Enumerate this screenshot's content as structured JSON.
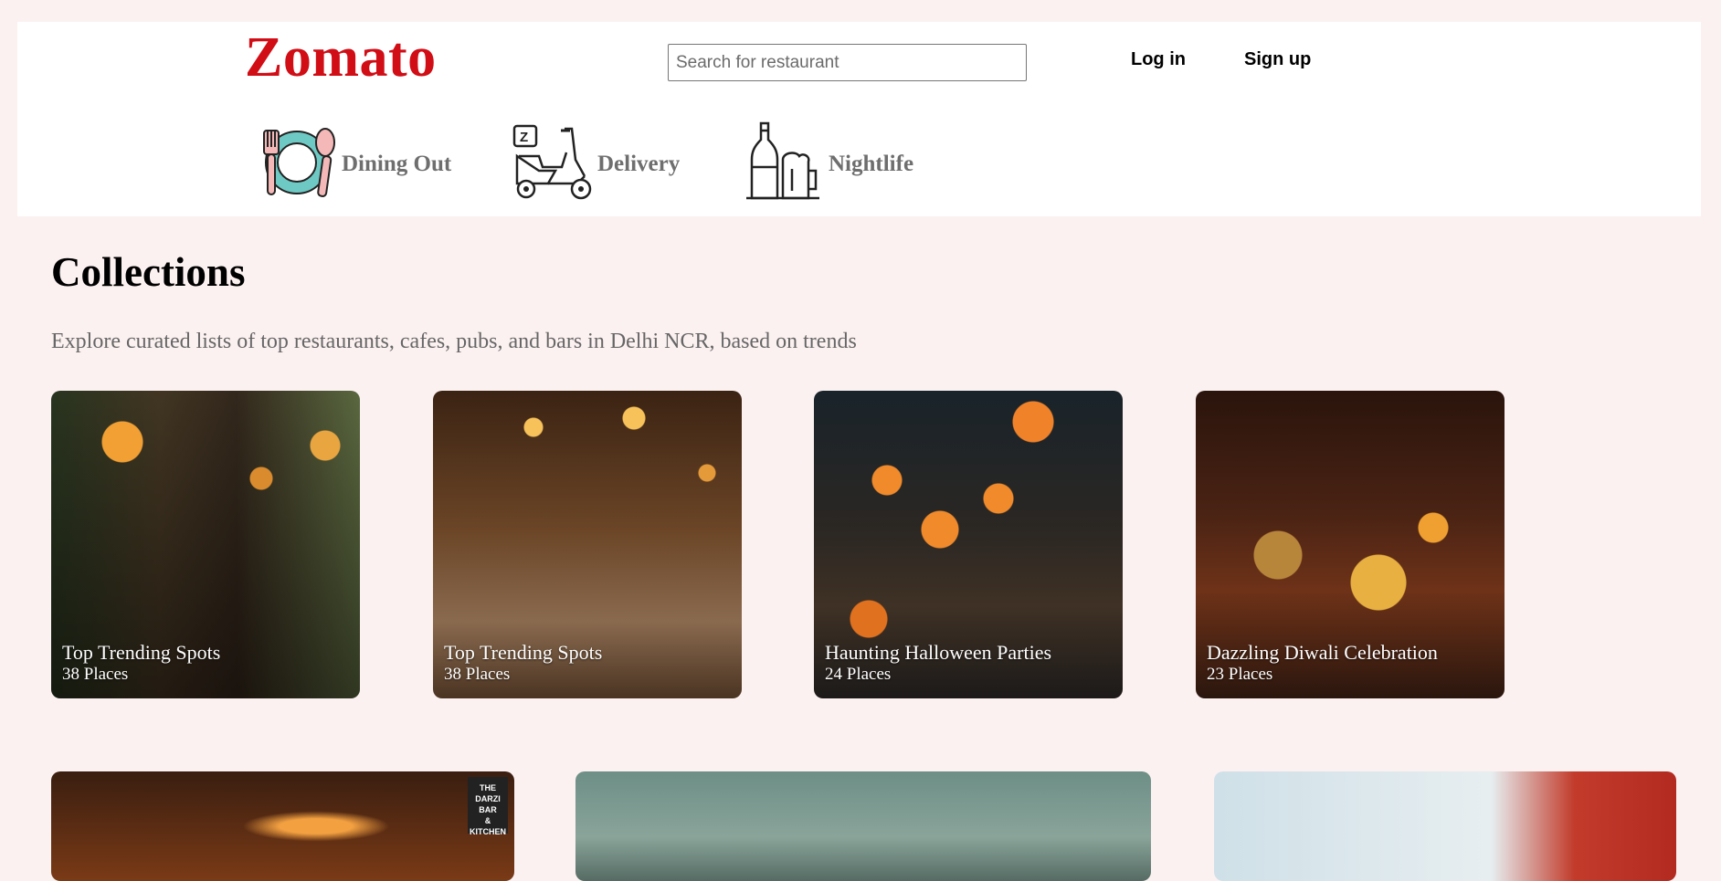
{
  "header": {
    "logo": "Zomato",
    "search_placeholder": "Search for restaurant",
    "login_label": "Log in",
    "signup_label": "Sign up",
    "categories": [
      {
        "label": "Dining Out",
        "icon": "dining-icon"
      },
      {
        "label": "Delivery",
        "icon": "scooter-icon"
      },
      {
        "label": "Nightlife",
        "icon": "drinks-icon"
      }
    ]
  },
  "collections": {
    "title": "Collections",
    "subtitle": "Explore curated lists of top restaurants, cafes, pubs, and bars in Delhi NCR, based on trends",
    "cards": [
      {
        "name": "Top Trending Spots",
        "places": "38 Places"
      },
      {
        "name": "Top Trending Spots",
        "places": "38 Places"
      },
      {
        "name": "Haunting Halloween Parties",
        "places": "24 Places"
      },
      {
        "name": "Dazzling Diwali Celebration",
        "places": "23 Places"
      }
    ],
    "second_row_badge": [
      "THE",
      "DARZI",
      "BAR",
      "& KITCHEN"
    ]
  },
  "colors": {
    "brand_red": "#d10d16",
    "page_background": "#fcf1f1",
    "header_background": "#ffffff",
    "category_text": "#6e6e6e"
  }
}
